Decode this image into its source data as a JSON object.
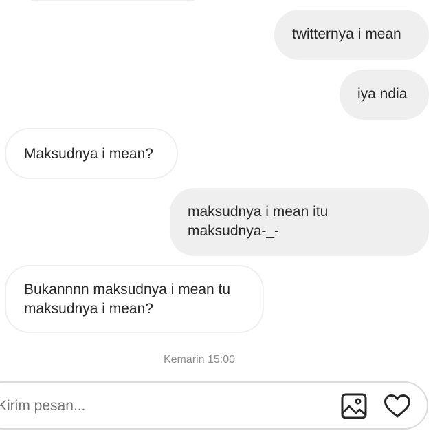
{
  "messages": [
    {
      "id": "m1",
      "side": "sent",
      "lines": [
        "twitternya i mean"
      ]
    },
    {
      "id": "m2",
      "side": "sent",
      "lines": [
        "iya ndia"
      ]
    },
    {
      "id": "m3",
      "side": "received",
      "lines": [
        "Maksudnya i mean?"
      ]
    },
    {
      "id": "m4",
      "side": "sent",
      "lines": [
        "maksudnya i mean itu",
        "maksudnya-_-"
      ]
    },
    {
      "id": "m5",
      "side": "received",
      "lines": [
        "Bukannnn maksudnya i mean tu",
        "maksudnya i mean?"
      ]
    }
  ],
  "timestamp": "Kemarin 15:00",
  "composer": {
    "placeholder": "Kirim pesan...",
    "value": ""
  },
  "icons": {
    "image": "image-icon",
    "like": "heart-icon"
  },
  "colors": {
    "sent_bubble": "#efefef",
    "received_border": "#efefef",
    "text": "#262626",
    "timestamp": "#8e8e8e",
    "composer_border": "#dbdbdb"
  }
}
